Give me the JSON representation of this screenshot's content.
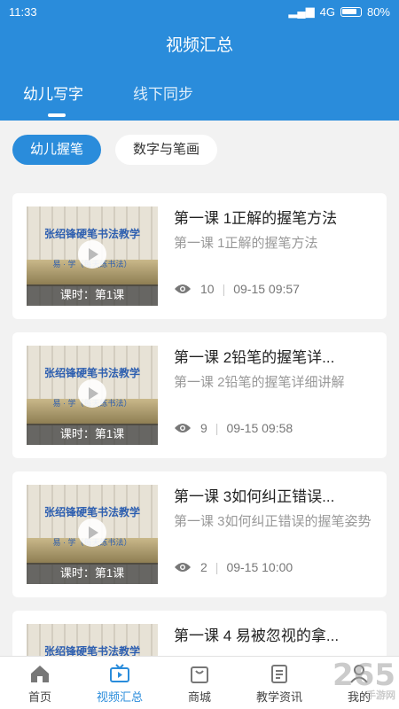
{
  "status": {
    "time": "11:33",
    "network": "4G",
    "battery": "80%"
  },
  "header": {
    "title": "视频汇总"
  },
  "tabs": [
    {
      "label": "幼儿写字",
      "active": true
    },
    {
      "label": "线下同步",
      "active": false
    }
  ],
  "filters": [
    {
      "label": "幼儿握笔",
      "active": true
    },
    {
      "label": "数字与笔画",
      "active": false
    }
  ],
  "thumb": {
    "heading": "张绍锋硬笔书法教学",
    "subtitle": "易 · 学（每天练书法）"
  },
  "cards": [
    {
      "title": "第一课 1正解的握笔方法",
      "desc": "第一课 1正解的握笔方法",
      "lesson": "课时：第1课",
      "views": "10",
      "date": "09-15 09:57"
    },
    {
      "title": "第一课 2铅笔的握笔详...",
      "desc": "第一课 2铅笔的握笔详细讲解",
      "lesson": "课时：第1课",
      "views": "9",
      "date": "09-15 09:58"
    },
    {
      "title": "第一课 3如何纠正错误...",
      "desc": "第一课 3如何纠正错误的握笔姿势",
      "lesson": "课时：第1课",
      "views": "2",
      "date": "09-15 10:00"
    },
    {
      "title": "第一课 4 易被忽视的拿...",
      "desc": "",
      "lesson": "",
      "views": "",
      "date": ""
    }
  ],
  "nav": [
    {
      "label": "首页",
      "icon": "home-icon",
      "active": false
    },
    {
      "label": "视频汇总",
      "icon": "tv-icon",
      "active": true
    },
    {
      "label": "商城",
      "icon": "shopping-bag-icon",
      "active": false
    },
    {
      "label": "教学资讯",
      "icon": "news-icon",
      "active": false
    },
    {
      "label": "我的",
      "icon": "profile-icon",
      "active": false
    }
  ],
  "watermark": {
    "main": "265",
    "sub": "手游网"
  },
  "colors": {
    "primary": "#2a8cdb",
    "background": "#f2f2f2"
  }
}
